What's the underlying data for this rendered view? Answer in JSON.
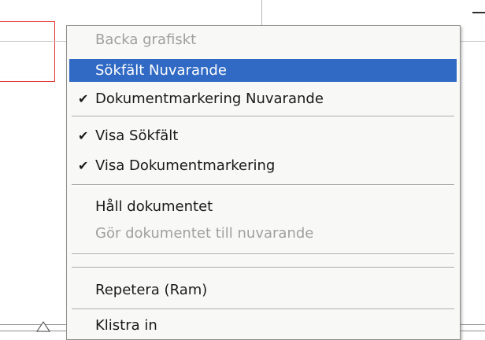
{
  "menu": {
    "items": [
      {
        "label": "Backa grafiskt",
        "state": "disabled",
        "checked": false
      },
      {
        "label": "Sökfält Nuvarande",
        "state": "highlighted",
        "checked": false
      },
      {
        "label": "Dokumentmarkering Nuvarande",
        "state": "enabled",
        "checked": true
      },
      {
        "label": "Visa Sökfält",
        "state": "enabled",
        "checked": true
      },
      {
        "label": "Visa Dokumentmarkering",
        "state": "enabled",
        "checked": true
      },
      {
        "label": "Håll dokumentet",
        "state": "enabled",
        "checked": false
      },
      {
        "label": "Gör dokumentet till nuvarande",
        "state": "disabled",
        "checked": false
      },
      {
        "label": "Repetera (Ram)",
        "state": "enabled",
        "checked": false
      },
      {
        "label": "Klistra in",
        "state": "enabled",
        "checked": false
      }
    ],
    "check_glyph": "✔"
  },
  "colors": {
    "highlight": "#316ac5",
    "disabled_text": "#a0a0a0",
    "annotation_red": "#e03030"
  }
}
